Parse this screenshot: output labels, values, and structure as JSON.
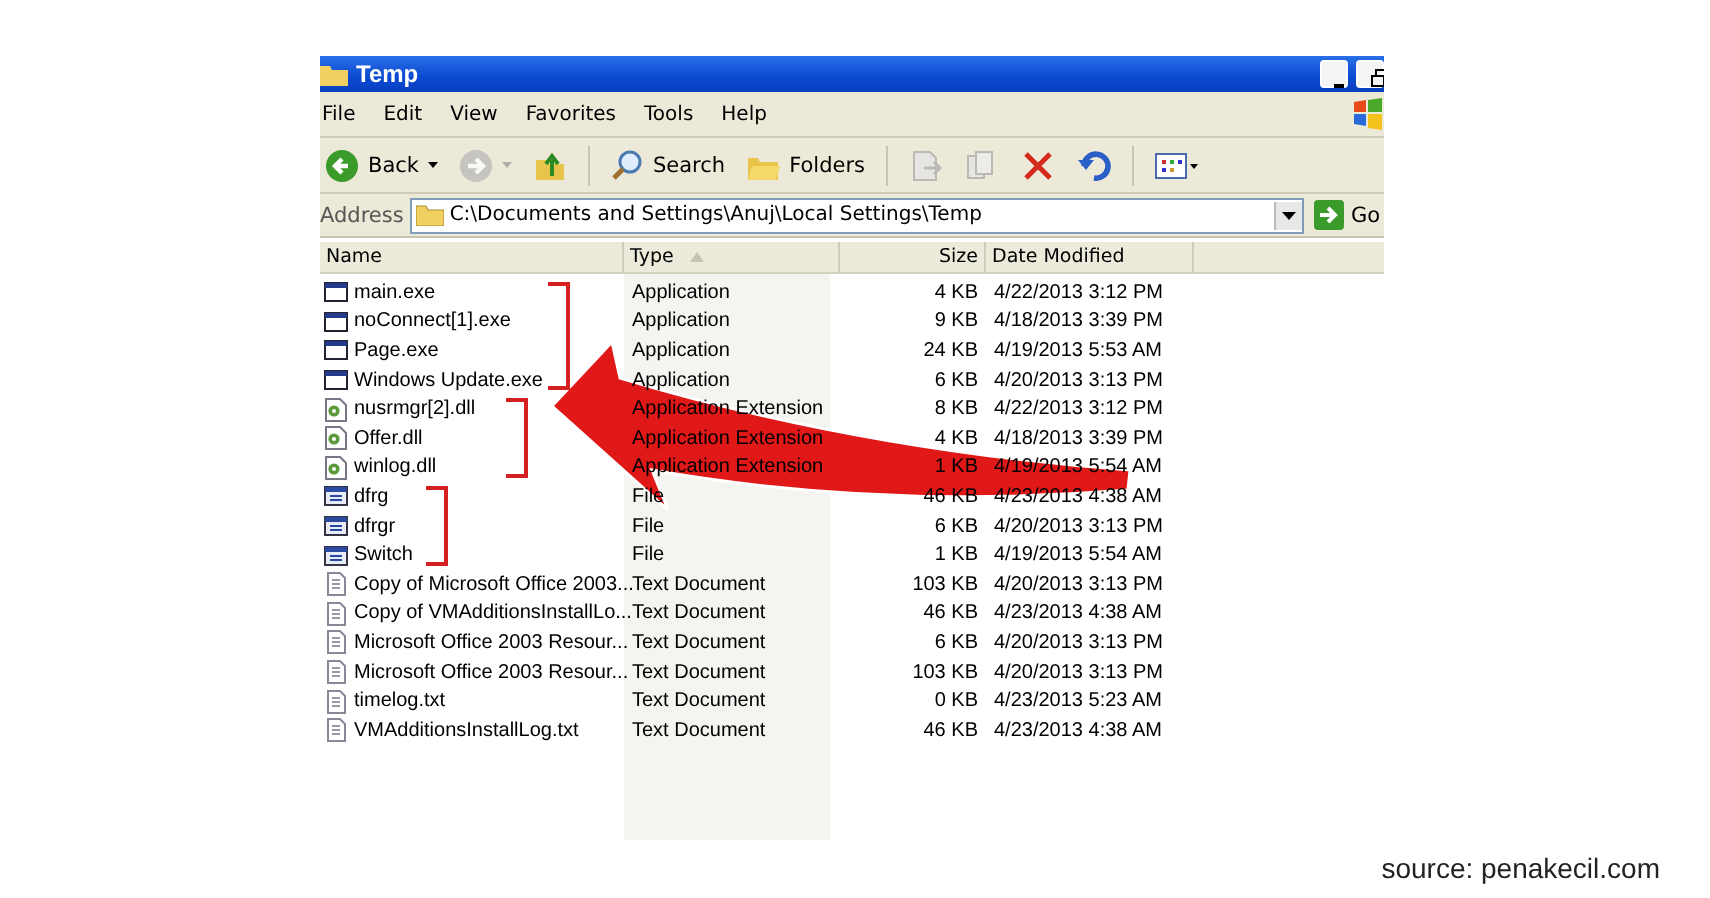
{
  "window": {
    "title": "Temp"
  },
  "menu": [
    "File",
    "Edit",
    "View",
    "Favorites",
    "Tools",
    "Help"
  ],
  "toolbar": [
    {
      "kind": "back",
      "label": "Back",
      "disabled": false
    },
    {
      "kind": "forward",
      "disabled": true
    },
    {
      "kind": "up",
      "disabled": false
    },
    {
      "kind": "search",
      "label": "Search",
      "disabled": false
    },
    {
      "kind": "folders",
      "label": "Folders",
      "disabled": false
    },
    {
      "kind": "move",
      "disabled": true
    },
    {
      "kind": "copy",
      "disabled": true
    },
    {
      "kind": "delete",
      "disabled": false
    },
    {
      "kind": "undo",
      "disabled": false
    },
    {
      "kind": "views",
      "disabled": false
    }
  ],
  "address": {
    "label": "Address",
    "value": "C:\\Documents and Settings\\Anuj\\Local Settings\\Temp",
    "go": "Go"
  },
  "columns": [
    {
      "label": "Name",
      "sorted": false
    },
    {
      "label": "Type",
      "sorted": true
    },
    {
      "label": "Size",
      "sorted": false
    },
    {
      "label": "Date Modified",
      "sorted": false
    }
  ],
  "files": [
    {
      "name": "main.exe",
      "type": "Application",
      "size": "4 KB",
      "date": "4/22/2013 3:12 PM",
      "kind": "exe",
      "marked": true
    },
    {
      "name": "noConnect[1].exe",
      "type": "Application",
      "size": "9 KB",
      "date": "4/18/2013 3:39 PM",
      "kind": "exe",
      "marked": true
    },
    {
      "name": "Page.exe",
      "type": "Application",
      "size": "24 KB",
      "date": "4/19/2013 5:53 AM",
      "kind": "exe",
      "marked": true
    },
    {
      "name": "Windows Update.exe",
      "type": "Application",
      "size": "6 KB",
      "date": "4/20/2013 3:13 PM",
      "kind": "exe",
      "marked": true
    },
    {
      "name": "nusrmgr[2].dll",
      "type": "Application Extension",
      "size": "8 KB",
      "date": "4/22/2013 3:12 PM",
      "kind": "dll",
      "marked": true
    },
    {
      "name": "Offer.dll",
      "type": "Application Extension",
      "size": "4 KB",
      "date": "4/18/2013 3:39 PM",
      "kind": "dll",
      "marked": true
    },
    {
      "name": "winlog.dll",
      "type": "Application Extension",
      "size": "1 KB",
      "date": "4/19/2013 5:54 AM",
      "kind": "dll",
      "marked": true
    },
    {
      "name": "dfrg",
      "type": "File",
      "size": "46 KB",
      "date": "4/23/2013 4:38 AM",
      "kind": "file",
      "marked": true
    },
    {
      "name": "dfrgr",
      "type": "File",
      "size": "6 KB",
      "date": "4/20/2013 3:13 PM",
      "kind": "file",
      "marked": true
    },
    {
      "name": "Switch",
      "type": "File",
      "size": "1 KB",
      "date": "4/19/2013 5:54 AM",
      "kind": "file",
      "marked": true
    },
    {
      "name": "Copy of Microsoft Office 2003...",
      "type": "Text Document",
      "size": "103 KB",
      "date": "4/20/2013 3:13 PM",
      "kind": "txt",
      "marked": false
    },
    {
      "name": "Copy of VMAdditionsInstallLo...",
      "type": "Text Document",
      "size": "46 KB",
      "date": "4/23/2013 4:38 AM",
      "kind": "txt",
      "marked": false
    },
    {
      "name": "Microsoft Office 2003 Resour...",
      "type": "Text Document",
      "size": "6 KB",
      "date": "4/20/2013 3:13 PM",
      "kind": "txt",
      "marked": false
    },
    {
      "name": "Microsoft Office 2003 Resour...",
      "type": "Text Document",
      "size": "103 KB",
      "date": "4/20/2013 3:13 PM",
      "kind": "txt",
      "marked": false
    },
    {
      "name": "timelog.txt",
      "type": "Text Document",
      "size": "0 KB",
      "date": "4/23/2013 5:23 AM",
      "kind": "txt",
      "marked": false
    },
    {
      "name": "VMAdditionsInstallLog.txt",
      "type": "Text Document",
      "size": "46 KB",
      "date": "4/23/2013 4:38 AM",
      "kind": "txt",
      "marked": false
    }
  ],
  "caption": "source: penakecil.com"
}
